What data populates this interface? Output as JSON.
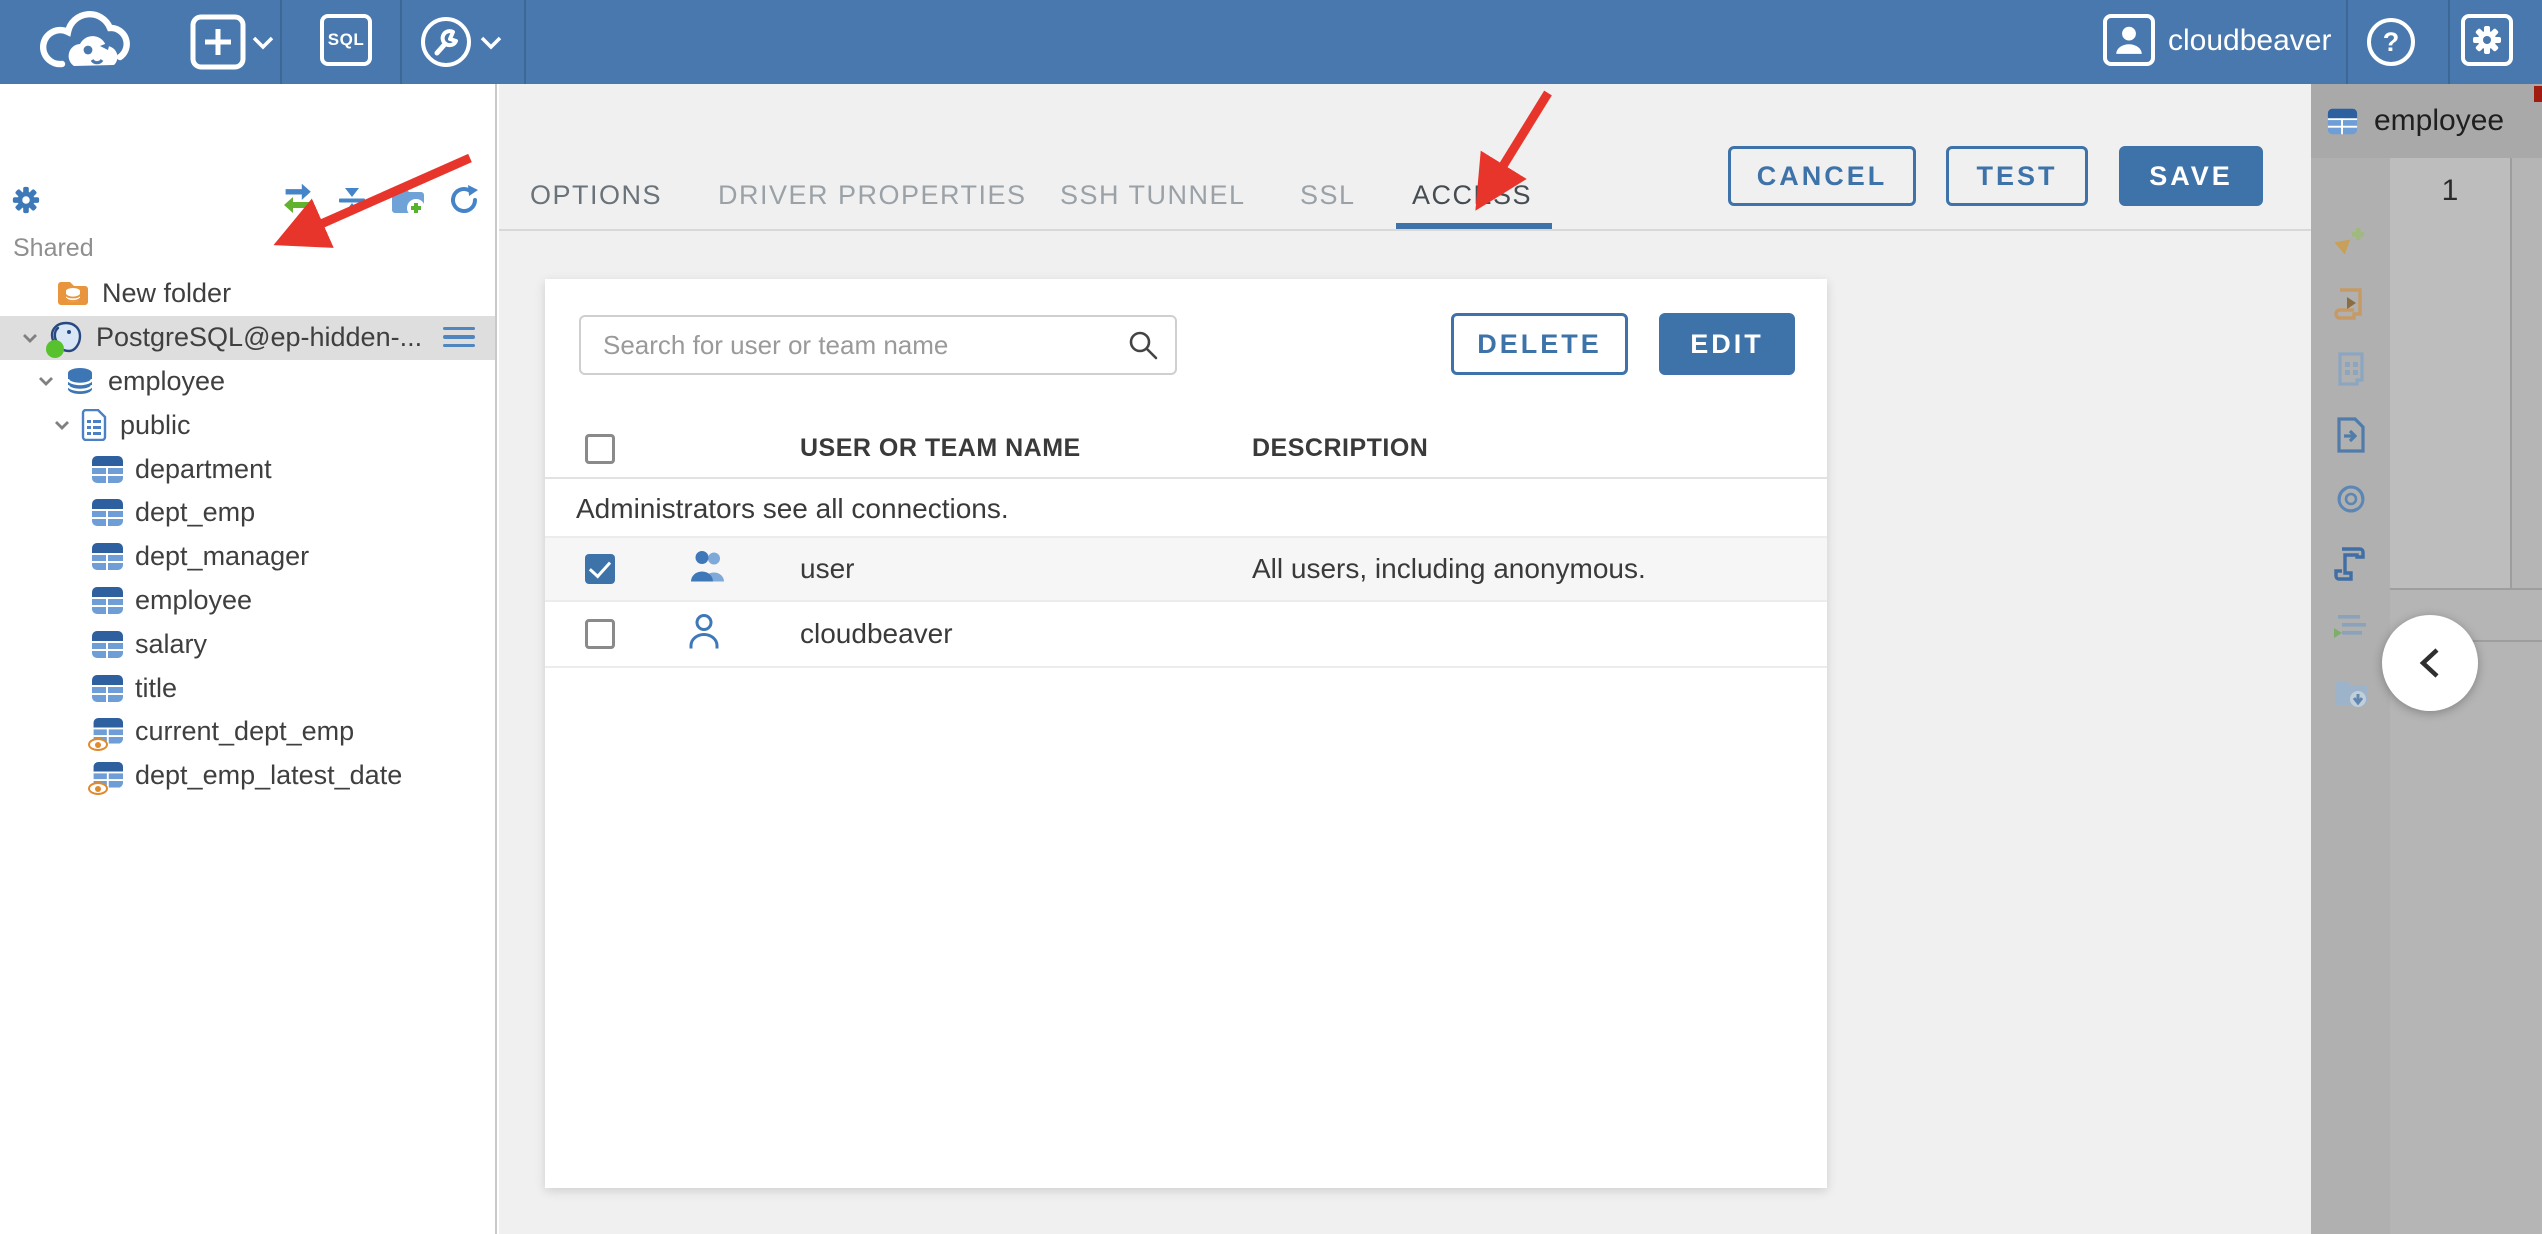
{
  "topbar": {
    "user_label": "cloudbeaver",
    "sql_label": "SQL",
    "help_glyph": "?",
    "icons": [
      "cloudbeaver-logo",
      "plus-icon",
      "chevron-down-icon",
      "sql-editor-icon",
      "driver-wrench-icon",
      "chevron-down-icon",
      "user-avatar-icon",
      "help-icon",
      "settings-gear-icon"
    ]
  },
  "sidebar": {
    "section_label": "Shared",
    "toolbar_icons": [
      "settings-gear-icon",
      "link-editor-icon",
      "collapse-all-icon",
      "add-folder-icon",
      "refresh-icon"
    ],
    "tree": [
      {
        "label": "New folder",
        "icon": "folder-database-icon"
      },
      {
        "label": "PostgreSQL@ep-hidden-...",
        "icon": "postgresql-icon",
        "status": "connected",
        "selected": true
      },
      {
        "label": "employee",
        "icon": "database-icon"
      },
      {
        "label": "public",
        "icon": "schema-icon"
      },
      {
        "label": "department",
        "icon": "table-icon"
      },
      {
        "label": "dept_emp",
        "icon": "table-icon"
      },
      {
        "label": "dept_manager",
        "icon": "table-icon"
      },
      {
        "label": "employee",
        "icon": "table-icon"
      },
      {
        "label": "salary",
        "icon": "table-icon"
      },
      {
        "label": "title",
        "icon": "table-icon"
      },
      {
        "label": "current_dept_emp",
        "icon": "view-icon"
      },
      {
        "label": "dept_emp_latest_date",
        "icon": "view-icon"
      }
    ]
  },
  "tabs": [
    {
      "label": "OPTIONS",
      "active": false
    },
    {
      "label": "DRIVER PROPERTIES",
      "active": false
    },
    {
      "label": "SSH TUNNEL",
      "active": false
    },
    {
      "label": "SSL",
      "active": false
    },
    {
      "label": "ACCESS",
      "active": true
    }
  ],
  "actions": {
    "cancel": "CANCEL",
    "test": "TEST",
    "save": "SAVE"
  },
  "access": {
    "search_placeholder": "Search for user or team name",
    "delete_label": "DELETE",
    "edit_label": "EDIT",
    "columns": {
      "name": "USER OR TEAM NAME",
      "description": "DESCRIPTION"
    },
    "note": "Administrators see all connections.",
    "rows": [
      {
        "name": "user",
        "description": "All users, including anonymous.",
        "checked": true,
        "icon": "team-icon"
      },
      {
        "name": "cloudbeaver",
        "description": "",
        "checked": false,
        "icon": "user-icon"
      }
    ]
  },
  "right_panel": {
    "tab_label": "employee",
    "tab_icon": "table-icon",
    "row_number": "1",
    "toolbar_icons": [
      "add-row-icon",
      "run-script-icon",
      "grid-view-icon",
      "export-data-icon",
      "ai-assistant-icon",
      "sql-script-icon",
      "execution-plan-icon",
      "import-folder-icon"
    ],
    "collapse_icon": "chevron-left-icon"
  },
  "colors": {
    "topbar_blue": "#4878ad",
    "accent_blue": "#3e73a9",
    "main_bg": "#f0f0f0",
    "selection_gray": "#dedede",
    "right_panel_gray": "#b0b0b0",
    "annotation_red": "#e8352b",
    "connected_green": "#57c22d"
  }
}
